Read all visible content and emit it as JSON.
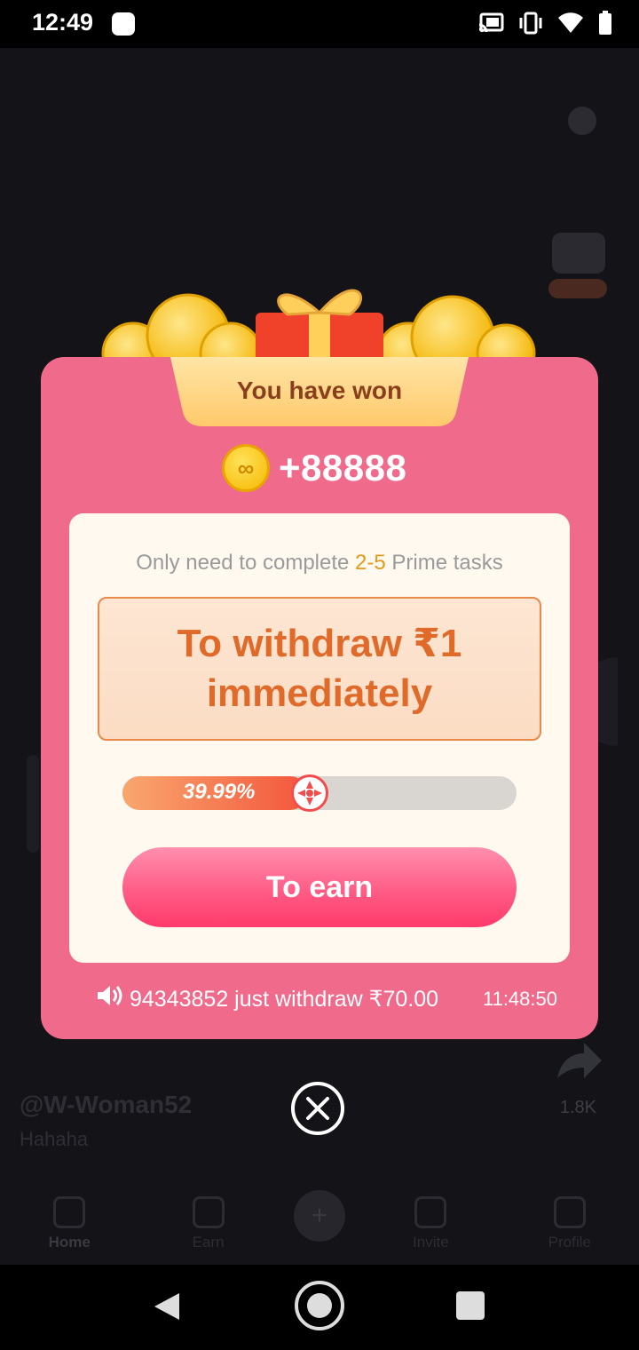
{
  "status_bar": {
    "time": "12:49",
    "icons": [
      "cast-icon",
      "vibrate-icon",
      "wifi-icon",
      "battery-icon"
    ]
  },
  "background": {
    "username": "@W-Woman52",
    "caption": "Hahaha",
    "share_count": "1.8K",
    "nav": [
      {
        "label": "Home",
        "active": true
      },
      {
        "label": "Earn",
        "active": false
      },
      {
        "label": "Invite",
        "active": false
      },
      {
        "label": "Profile",
        "active": false
      }
    ]
  },
  "modal": {
    "banner_title": "You have won",
    "reward_amount": "+88888",
    "task_prefix": "Only need to complete ",
    "task_highlight": "2-5",
    "task_suffix": " Prime tasks",
    "withdraw_text": "To withdraw ₹1 immediately",
    "progress_label": "39.99%",
    "progress_value": 0.3999,
    "earn_button": "To earn",
    "ticker_message": "94343852 just withdraw ₹70.00",
    "ticker_time": "11:48:50"
  },
  "colors": {
    "modal_bg": "#f06a8c",
    "card_bg": "#fff9f0",
    "withdraw_text": "#e06a2a",
    "highlight": "#e39a1a",
    "button": "#ff5c86"
  }
}
